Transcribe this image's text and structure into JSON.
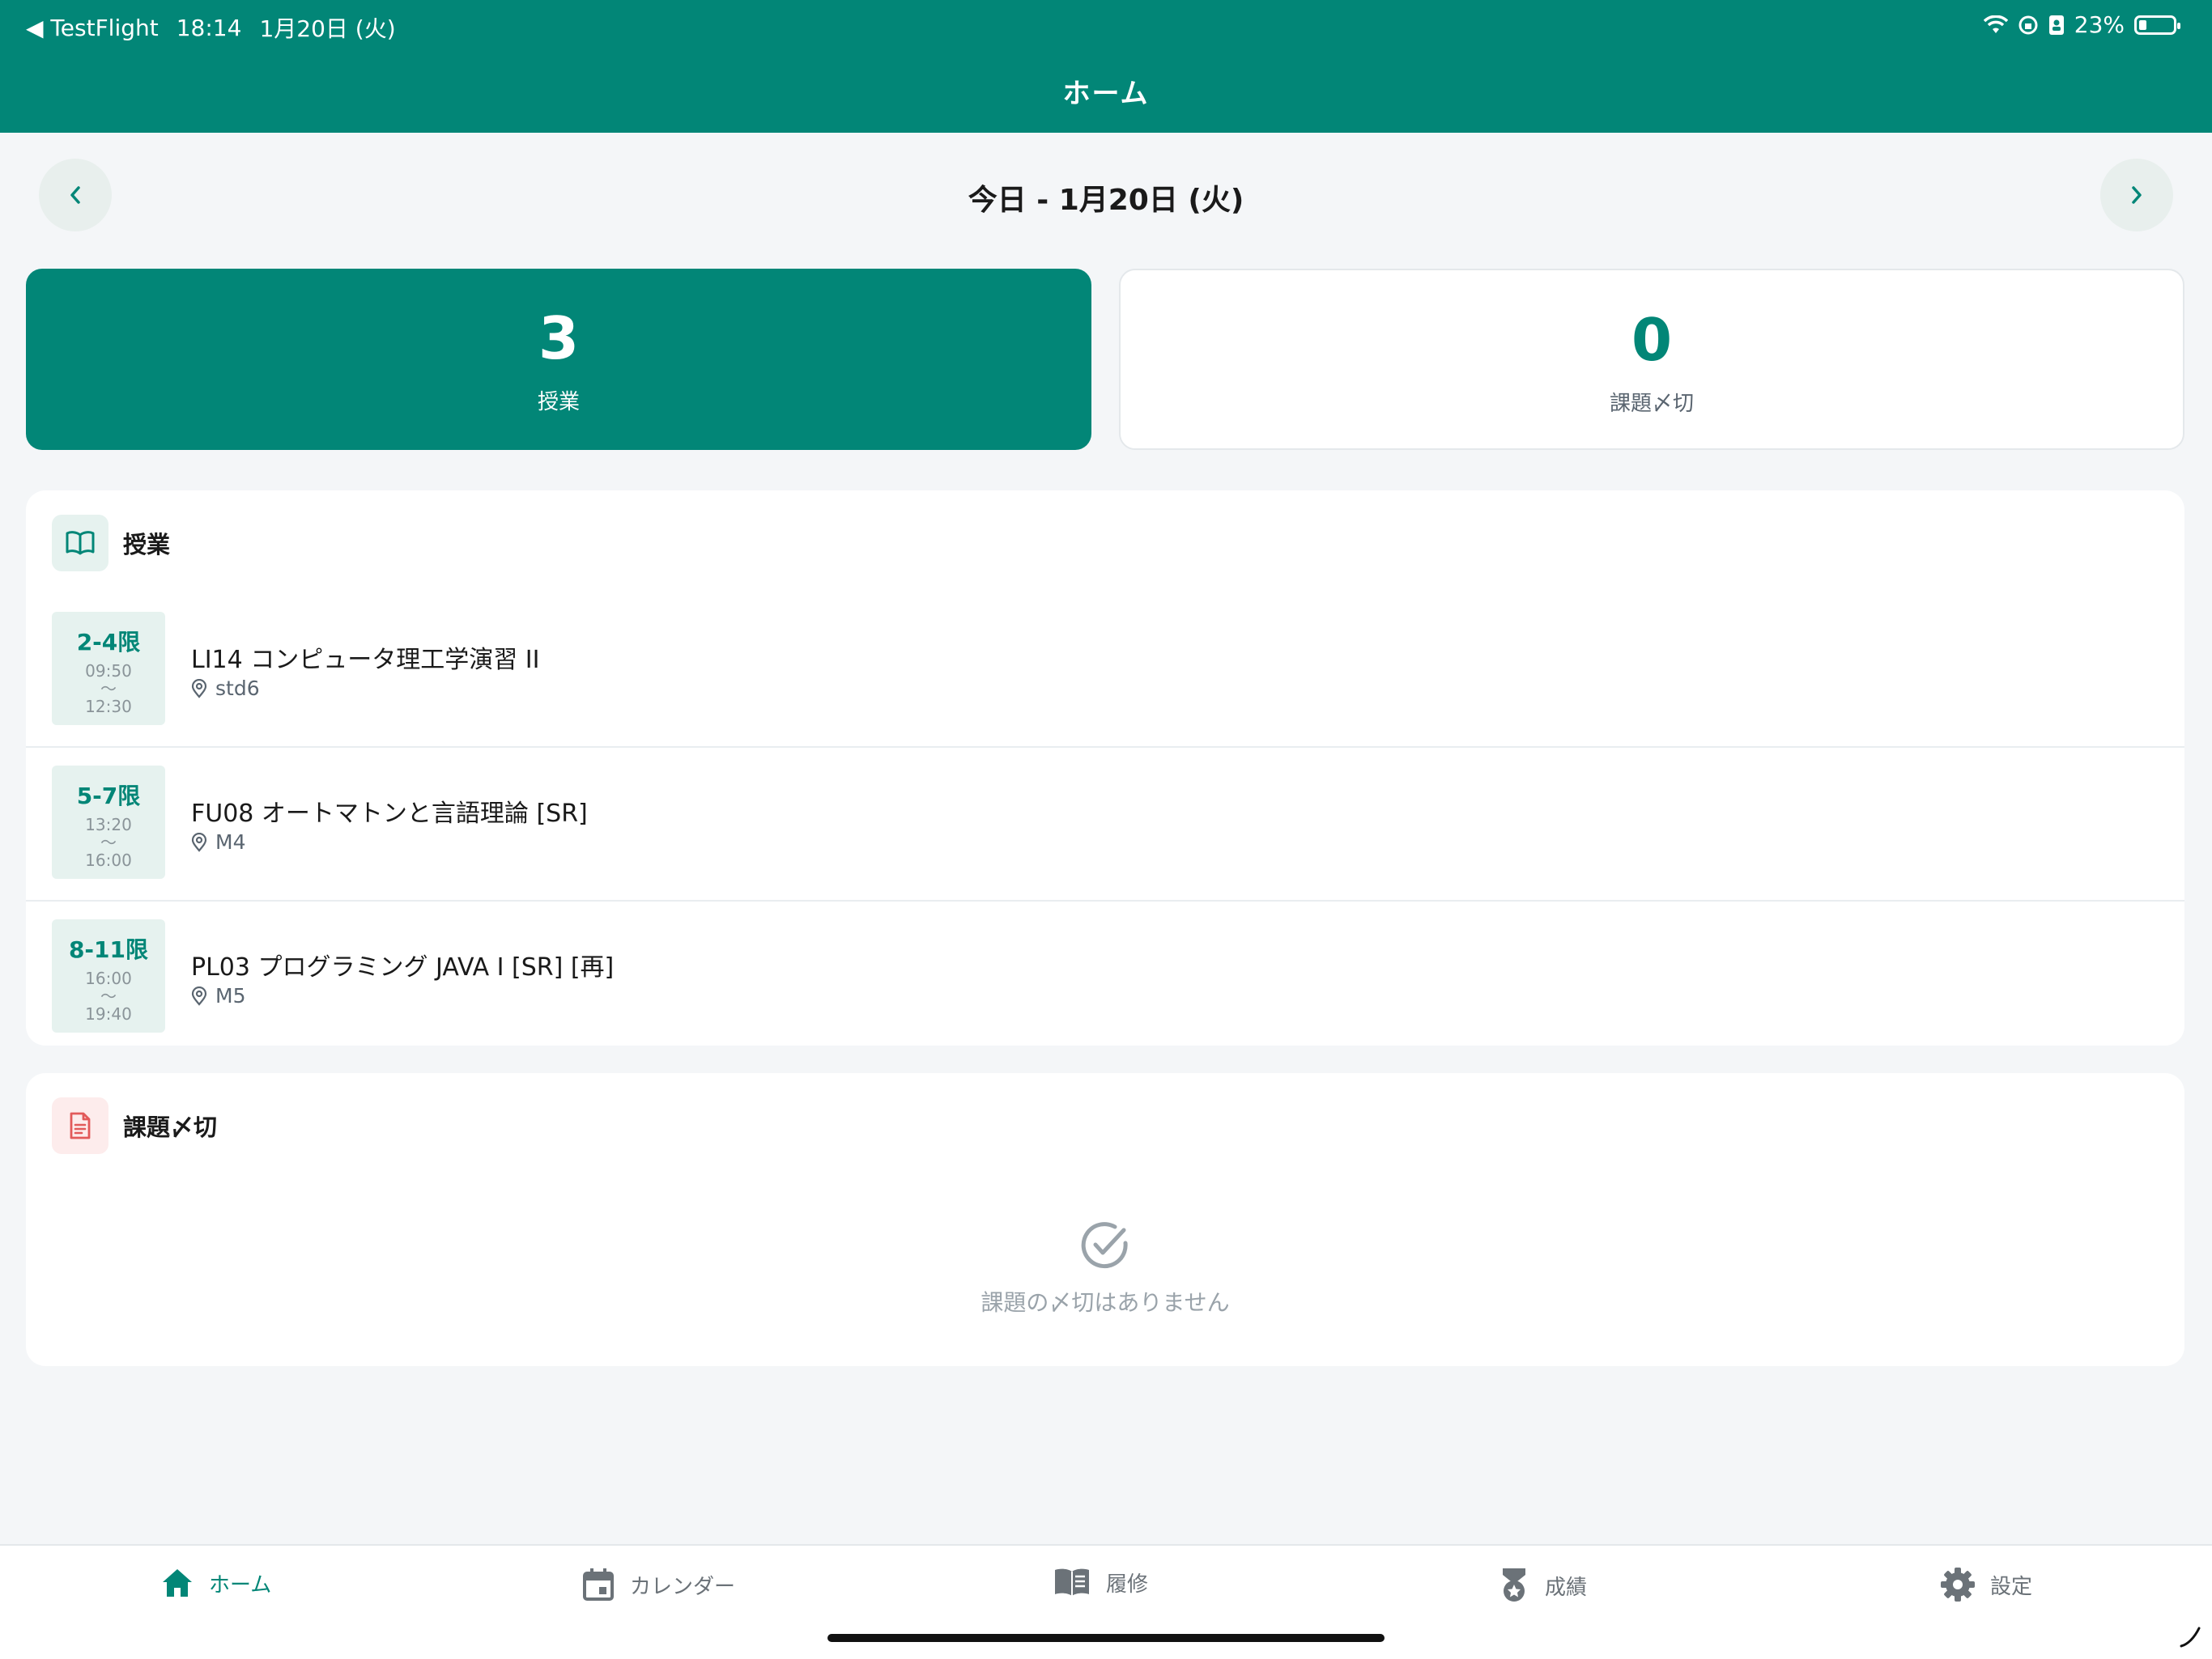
{
  "status_bar": {
    "back_app": "◀ TestFlight",
    "time": "18:14",
    "date": "1月20日 (火)",
    "battery": "23%",
    "battery_level": 0.23
  },
  "header": {
    "title": "ホーム"
  },
  "date_nav": {
    "label": "今日 - 1月20日 (火)",
    "prev_icon": "chevron-left",
    "next_icon": "chevron-right"
  },
  "summary": {
    "classes": {
      "count": "3",
      "label": "授業"
    },
    "assignments": {
      "count": "0",
      "label": "課題〆切"
    }
  },
  "classes_card": {
    "title": "授業",
    "icon": "book-open-icon",
    "items": [
      {
        "period": "2-4限",
        "start": "09:50",
        "sep": "〜",
        "end": "12:30",
        "name": "LI14 コンピュータ理工学演習 II",
        "room": "std6"
      },
      {
        "period": "5-7限",
        "start": "13:20",
        "sep": "〜",
        "end": "16:00",
        "name": "FU08 オートマトンと言語理論 [SR]",
        "room": "M4"
      },
      {
        "period": "8-11限",
        "start": "16:00",
        "sep": "〜",
        "end": "19:40",
        "name": "PL03 プログラミング JAVA I [SR] [再]",
        "room": "M5"
      }
    ]
  },
  "assignments_card": {
    "title": "課題〆切",
    "icon": "document-icon",
    "empty_message": "課題の〆切はありません"
  },
  "tabs": [
    {
      "label": "ホーム",
      "icon": "home-icon",
      "active": true
    },
    {
      "label": "カレンダー",
      "icon": "calendar-icon",
      "active": false
    },
    {
      "label": "履修",
      "icon": "book-icon",
      "active": false
    },
    {
      "label": "成績",
      "icon": "medal-icon",
      "active": false
    },
    {
      "label": "設定",
      "icon": "gear-icon",
      "active": false
    }
  ],
  "colors": {
    "primary": "#028677",
    "background": "#f4f6f8",
    "danger_tint": "#fdecec"
  }
}
